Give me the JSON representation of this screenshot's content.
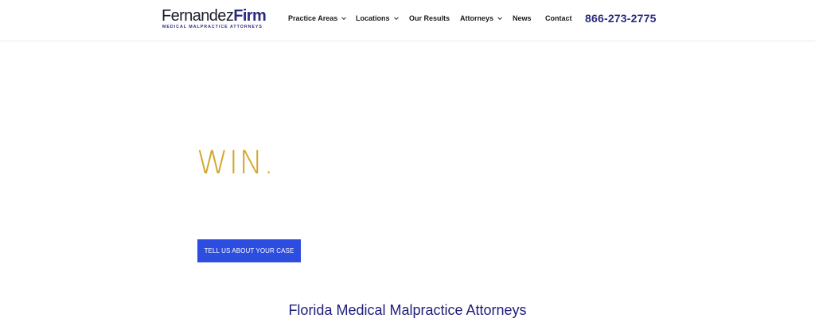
{
  "header": {
    "logo": {
      "name_light": "Fernandez",
      "name_bold": "Firm",
      "tagline": "MEDICAL MALPRACTICE ATTORNEYS"
    },
    "nav": [
      {
        "label": "Practice Areas",
        "has_dropdown": true
      },
      {
        "label": "Locations",
        "has_dropdown": true
      },
      {
        "label": "Our Results",
        "has_dropdown": false
      },
      {
        "label": "Attorneys",
        "has_dropdown": true
      },
      {
        "label": "News",
        "has_dropdown": false
      },
      {
        "label": "Contact",
        "has_dropdown": false
      }
    ],
    "phone": "866-273-2775"
  },
  "hero": {
    "headline": "WIN.",
    "cta_label": "TELL US ABOUT YOUR CASE"
  },
  "section": {
    "title": "Florida Medical Malpractice Attorneys"
  },
  "colors": {
    "brand_navy": "#2b2a83",
    "accent_gold": "#d4a52a",
    "cta_blue": "#2c4de0"
  }
}
